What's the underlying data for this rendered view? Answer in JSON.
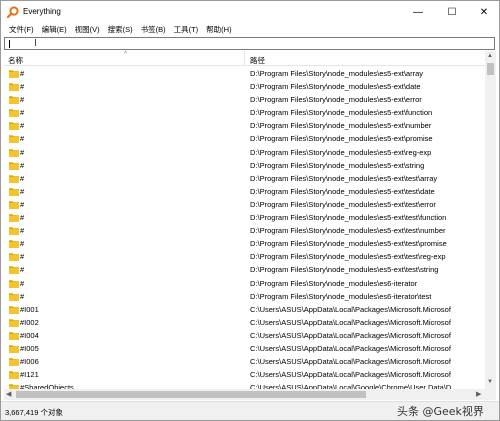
{
  "window": {
    "title": "Everything",
    "controls": {
      "minimize": "—",
      "maximize": "☐",
      "close": "✕"
    }
  },
  "menu": [
    "文件(F)",
    "编辑(E)",
    "视图(V)",
    "搜索(S)",
    "书签(B)",
    "工具(T)",
    "帮助(H)"
  ],
  "search": {
    "value": "",
    "placeholder": ""
  },
  "columns": {
    "name": "名称",
    "path": "路径",
    "sort_indicator": "^"
  },
  "rows": [
    {
      "name": "#",
      "path": "D:\\Program Files\\Story\\node_modules\\es5-ext\\array"
    },
    {
      "name": "#",
      "path": "D:\\Program Files\\Story\\node_modules\\es5-ext\\date"
    },
    {
      "name": "#",
      "path": "D:\\Program Files\\Story\\node_modules\\es5-ext\\error"
    },
    {
      "name": "#",
      "path": "D:\\Program Files\\Story\\node_modules\\es5-ext\\function"
    },
    {
      "name": "#",
      "path": "D:\\Program Files\\Story\\node_modules\\es5-ext\\number"
    },
    {
      "name": "#",
      "path": "D:\\Program Files\\Story\\node_modules\\es5-ext\\promise"
    },
    {
      "name": "#",
      "path": "D:\\Program Files\\Story\\node_modules\\es5-ext\\reg-exp"
    },
    {
      "name": "#",
      "path": "D:\\Program Files\\Story\\node_modules\\es5-ext\\string"
    },
    {
      "name": "#",
      "path": "D:\\Program Files\\Story\\node_modules\\es5-ext\\test\\array"
    },
    {
      "name": "#",
      "path": "D:\\Program Files\\Story\\node_modules\\es5-ext\\test\\date"
    },
    {
      "name": "#",
      "path": "D:\\Program Files\\Story\\node_modules\\es5-ext\\test\\error"
    },
    {
      "name": "#",
      "path": "D:\\Program Files\\Story\\node_modules\\es5-ext\\test\\function"
    },
    {
      "name": "#",
      "path": "D:\\Program Files\\Story\\node_modules\\es5-ext\\test\\number"
    },
    {
      "name": "#",
      "path": "D:\\Program Files\\Story\\node_modules\\es5-ext\\test\\promise"
    },
    {
      "name": "#",
      "path": "D:\\Program Files\\Story\\node_modules\\es5-ext\\test\\reg-exp"
    },
    {
      "name": "#",
      "path": "D:\\Program Files\\Story\\node_modules\\es5-ext\\test\\string"
    },
    {
      "name": "#",
      "path": "D:\\Program Files\\Story\\node_modules\\es6-iterator"
    },
    {
      "name": "#",
      "path": "D:\\Program Files\\Story\\node_modules\\es6-iterator\\test"
    },
    {
      "name": "#I001",
      "path": "C:\\Users\\ASUS\\AppData\\Local\\Packages\\Microsoft.Microsof"
    },
    {
      "name": "#I002",
      "path": "C:\\Users\\ASUS\\AppData\\Local\\Packages\\Microsoft.Microsof"
    },
    {
      "name": "#I004",
      "path": "C:\\Users\\ASUS\\AppData\\Local\\Packages\\Microsoft.Microsof"
    },
    {
      "name": "#I005",
      "path": "C:\\Users\\ASUS\\AppData\\Local\\Packages\\Microsoft.Microsof"
    },
    {
      "name": "#I006",
      "path": "C:\\Users\\ASUS\\AppData\\Local\\Packages\\Microsoft.Microsof"
    },
    {
      "name": "#I121",
      "path": "C:\\Users\\ASUS\\AppData\\Local\\Packages\\Microsoft.Microsof"
    },
    {
      "name": "#SharedObjects",
      "path": "C:\\Users\\ASUS\\AppData\\Local\\Google\\Chrome\\User Data\\D"
    }
  ],
  "status": {
    "count": "3,667,419 个对象"
  },
  "watermark": "头条 @Geek视界",
  "icons": {
    "app": "magnifier-app-icon",
    "folder": "folder-icon"
  },
  "colors": {
    "folder": "#f4c430",
    "folder_dark": "#e0a800",
    "app_icon": "#e8731c"
  }
}
